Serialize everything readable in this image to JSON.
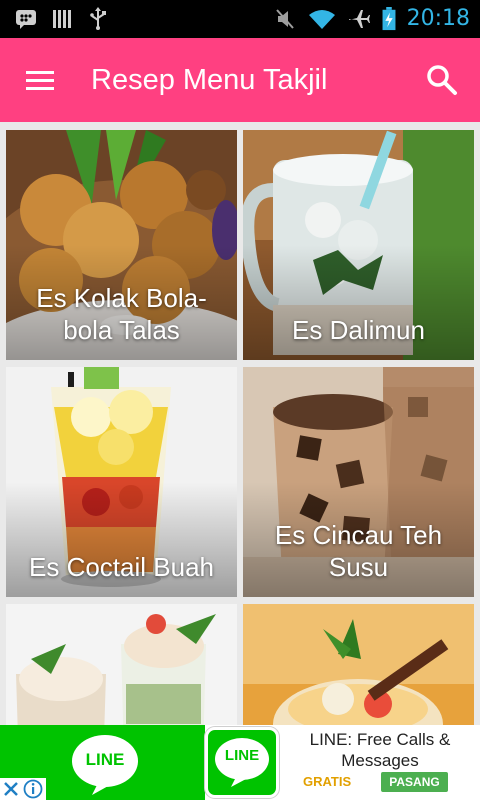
{
  "status_bar": {
    "time": "20:18",
    "icons": [
      "bbm-icon",
      "signal-bars-icon",
      "usb-icon",
      "mute-icon",
      "wifi-icon",
      "airplane-icon",
      "battery-charging-icon"
    ]
  },
  "app_bar": {
    "title": "Resep Menu Takjil",
    "menu_icon": "hamburger-menu-icon",
    "search_icon": "search-icon",
    "color": "#ff4081"
  },
  "recipes": [
    {
      "title": "Es Kolak Bola-bola Talas"
    },
    {
      "title": "Es Dalimun"
    },
    {
      "title": "Es Coctail Buah"
    },
    {
      "title": "Es Cincau Teh Susu"
    },
    {
      "title": ""
    },
    {
      "title": ""
    }
  ],
  "ad": {
    "brand": "LINE",
    "title": "LINE: Free Calls & Messages",
    "price": "GRATIS",
    "install_label": "PASANG",
    "accent": "#00c300"
  }
}
